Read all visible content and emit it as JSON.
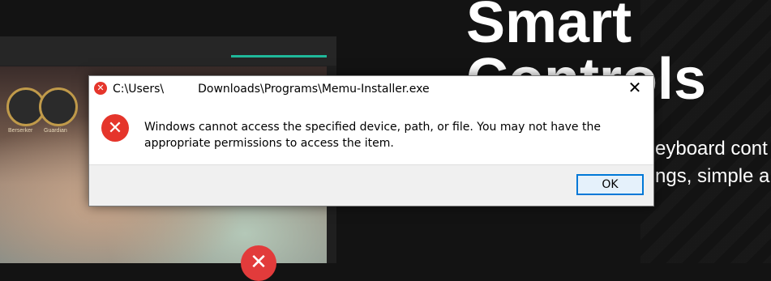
{
  "background": {
    "hero_title_line1": "Smart",
    "hero_title_line2": "Controls",
    "hero_line1": "eyboard cont",
    "hero_line2": "ngs, simple a",
    "game_badges": [
      "Berserker",
      "Guardian"
    ],
    "accent_color": "#1fb89a"
  },
  "dialog": {
    "title_prefix": "C:\\Users\\",
    "title_suffix": "Downloads\\Programs\\Memu-Installer.exe",
    "close_glyph": "✕",
    "error_icon": "error-x-icon",
    "message": "Windows cannot access the specified device, path, or file. You may not have the appropriate permissions to access the item.",
    "ok_label": "OK"
  }
}
